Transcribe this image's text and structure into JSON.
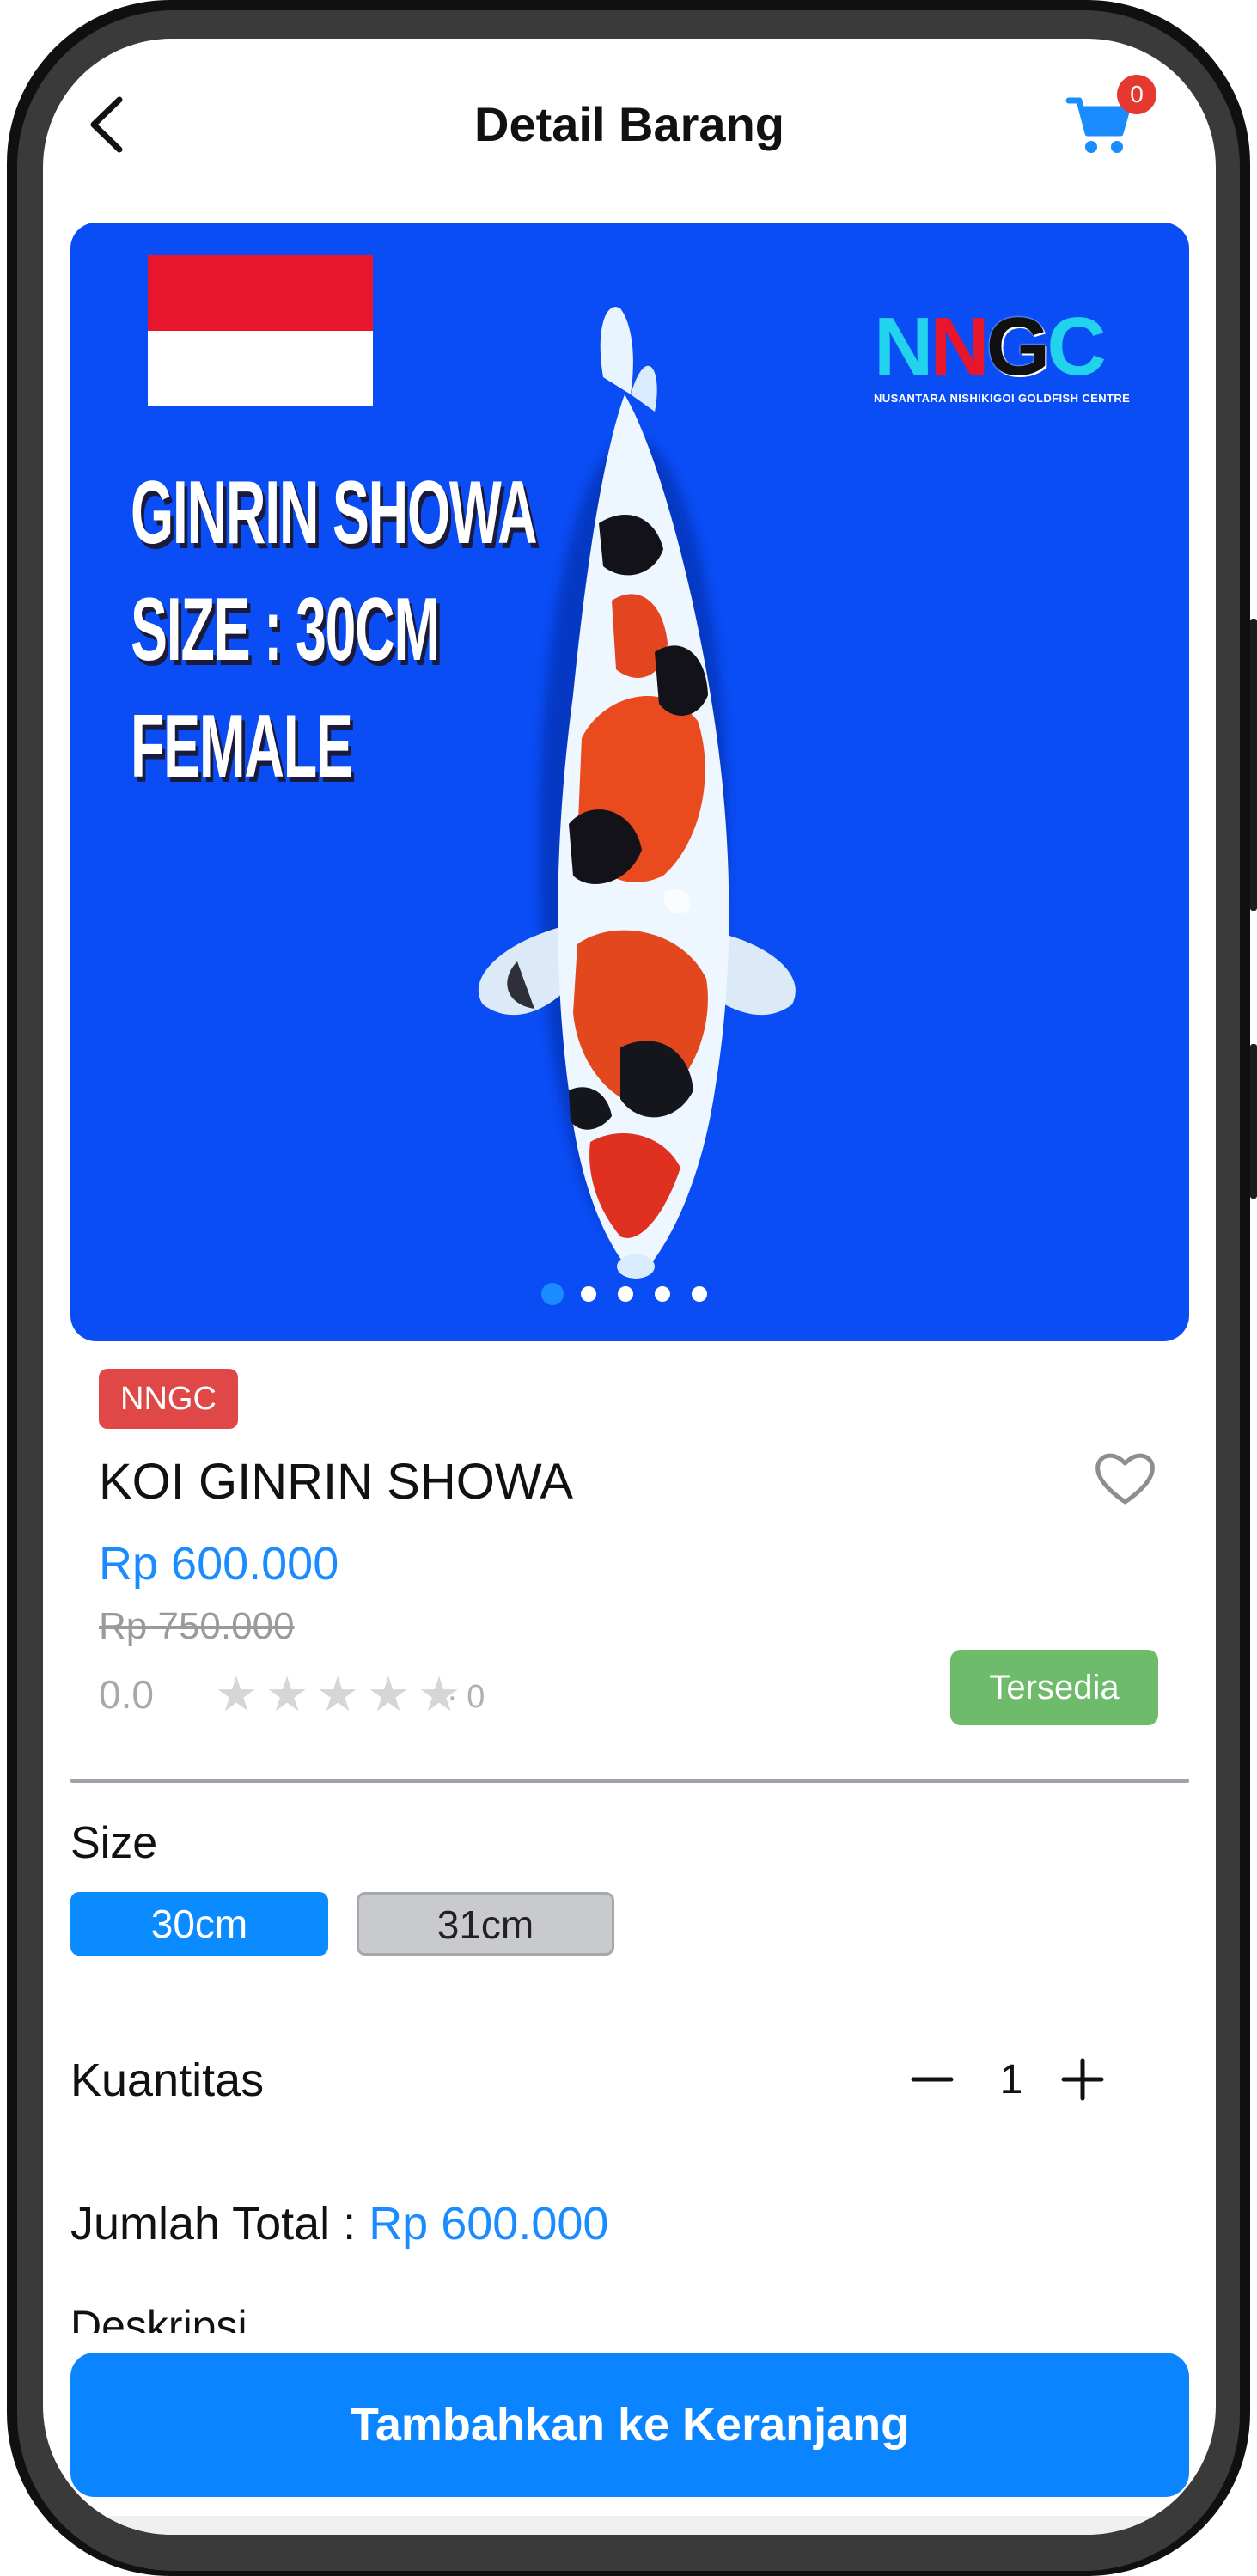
{
  "header": {
    "title": "Detail Barang",
    "cart_count": "0"
  },
  "banner": {
    "lines": [
      "GINRIN SHOWA",
      "SIZE : 30CM",
      "FEMALE"
    ],
    "logo_text": "NNGC",
    "logo_subtitle": "NUSANTARA NISHIKIGOI GOLDFISH CENTRE",
    "slide_count": 5,
    "active_slide": 1
  },
  "product": {
    "brand": "NNGC",
    "name": "KOI GINRIN SHOWA",
    "price": "Rp 600.000",
    "old_price": "Rp 750.000",
    "rating": "0.0",
    "rating_stars": 0,
    "review_count": "· 0",
    "status": "Tersedia"
  },
  "size": {
    "label": "Size",
    "options": [
      "30cm",
      "31cm"
    ],
    "selected": "30cm"
  },
  "quantity": {
    "label": "Kuantitas",
    "value": "1"
  },
  "total": {
    "label": "Jumlah Total : ",
    "value": "Rp 600.000"
  },
  "description": {
    "label": "Deskripsi"
  },
  "add_to_cart_label": "Tambahkan ke Keranjang",
  "colors": {
    "accent": "#0a85ff",
    "banner_bg": "#0a4df5",
    "brand_badge": "#e04848",
    "status_available": "#6dbb6b",
    "cart_badge": "#e6382f"
  }
}
